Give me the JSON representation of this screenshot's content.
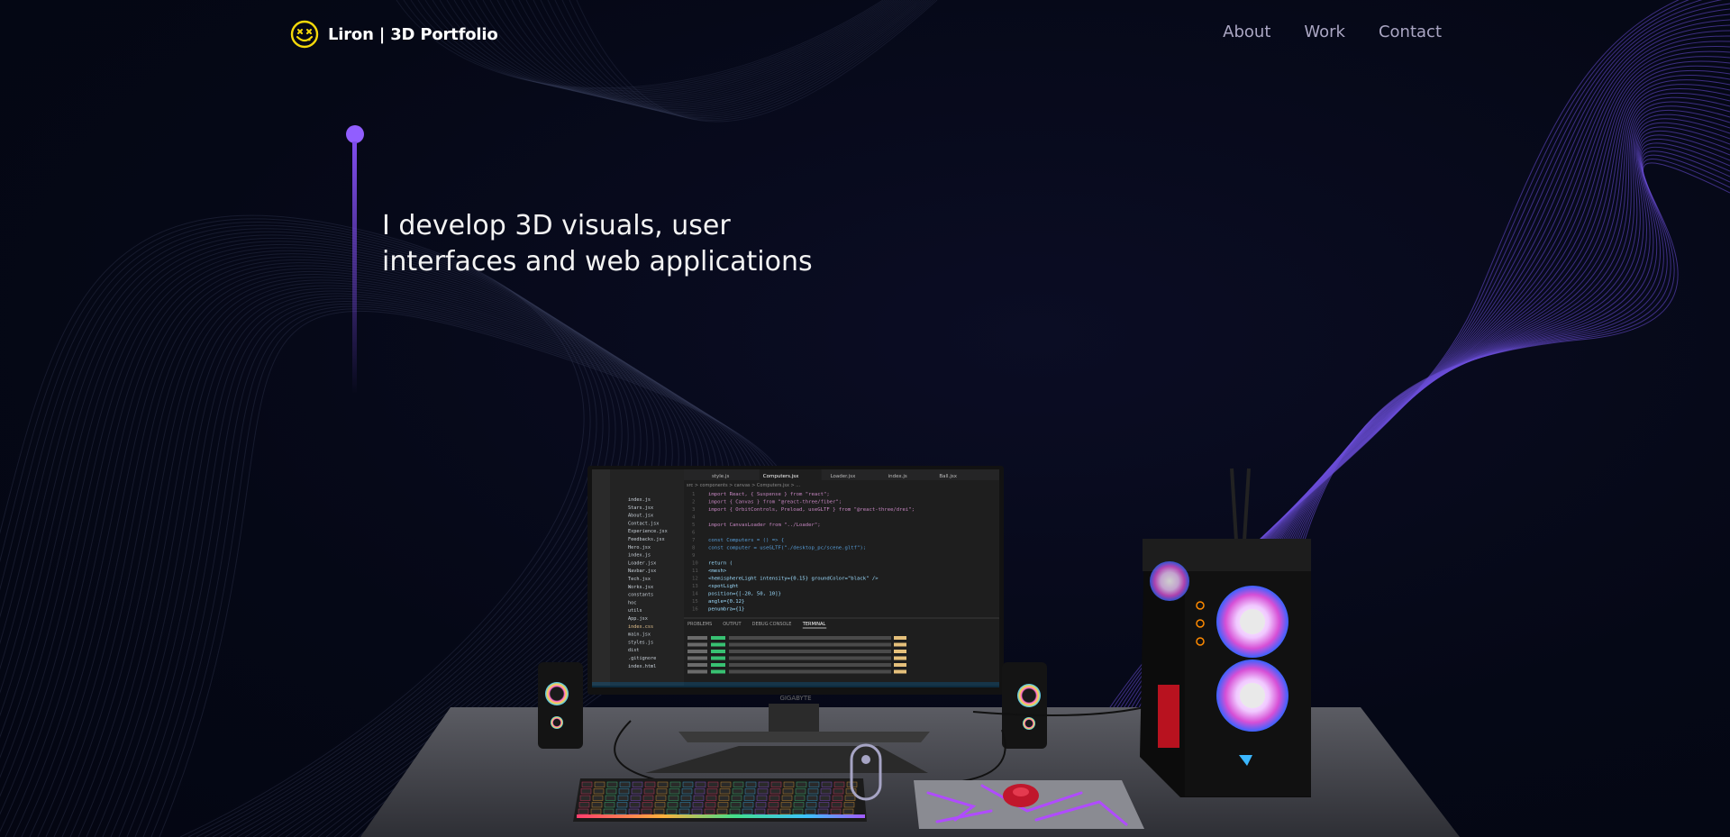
{
  "navbar": {
    "brand": "Liron | 3D Portfolio",
    "logo_icon": "smiley-face-icon",
    "links": [
      {
        "label": "About"
      },
      {
        "label": "Work"
      },
      {
        "label": "Contact"
      }
    ]
  },
  "hero": {
    "line1": "I develop 3D visuals, user",
    "line2": "interfaces and web applications"
  },
  "scene": {
    "monitor_brand": "GIGABYTE",
    "editor": {
      "tabs": [
        "style.js",
        "Computers.jsx",
        "Loader.jsx",
        "index.js",
        "Ball.jsx"
      ],
      "breadcrumb": "src > components > canvas > Computers.jsx > ...",
      "files": [
        "index.js",
        "Stars.jsx",
        "About.jsx",
        "Contact.jsx",
        "Experience.jsx",
        "Feedbacks.jsx",
        "Hero.jsx",
        "index.js",
        "Loader.jsx",
        "Navbar.jsx",
        "Tech.jsx",
        "Works.jsx",
        "constants",
        "hoc",
        "utils",
        "App.jsx",
        "index.css",
        "main.jsx",
        "styles.js",
        "dist",
        ".gitignore",
        "index.html"
      ],
      "code": [
        "import React, { Suspense } from \"react\";",
        "import { Canvas } from \"@react-three/fiber\";",
        "import { OrbitControls, Preload, useGLTF } from \"@react-three/drei\";",
        "",
        "import CanvasLoader from \"../Loader\";",
        "",
        "const Computers = () => {",
        "  const computer = useGLTF(\"./desktop_pc/scene.gltf\");",
        "",
        "  return (",
        "    <mesh>",
        "      <hemisphereLight intensity={0.15} groundColor=\"black\" />",
        "      <spotLight",
        "        position={[-20, 50, 10]}",
        "        angle={0.12}",
        "        penumbra={1}"
      ],
      "panel_tabs": [
        "PROBLEMS",
        "OUTPUT",
        "DEBUG CONSOLE",
        "TERMINAL"
      ]
    }
  },
  "colors": {
    "background": "#050816",
    "accent": "#915eff",
    "nav_link": "#aaa6c3",
    "logo_yellow": "#f5d90a"
  }
}
